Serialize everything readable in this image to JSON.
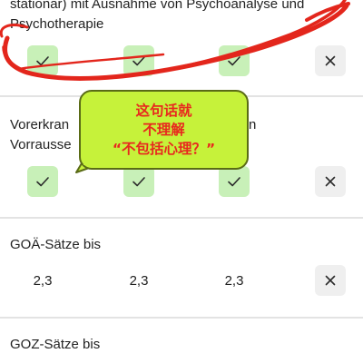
{
  "rows": [
    {
      "title_lines": [
        "stationar) mit Ausnahme von Psychoanalyse und",
        "Psychotherapie"
      ],
      "cells": [
        "check",
        "check",
        "check",
        "cross"
      ]
    },
    {
      "title_lines": [
        "Vorerkrankungen ohne besondere",
        "Vorraussetzungen versichert"
      ],
      "cells": [
        "check",
        "check",
        "check",
        "cross"
      ]
    },
    {
      "title": "GOÄ-Sätze bis",
      "values": [
        "2,3",
        "2,3",
        "2,3"
      ],
      "cells": [
        "cross"
      ]
    },
    {
      "title": "GOZ-Sätze bis"
    }
  ],
  "row2_visible_fragments": {
    "line1_left": "Vorerkran",
    "line1_right": "n",
    "line2_left": "Vorrausse"
  },
  "annotation": {
    "lines": [
      "这句话就",
      "不理解",
      "“不包括心理？”"
    ],
    "bubble_color": "#c6f23a",
    "text_color": "#e8281e",
    "scribble_color": "#e3261c"
  },
  "icons": {
    "check": "check-icon",
    "cross": "close-icon"
  },
  "colors": {
    "check_bg": "#c8f0b8",
    "cross_bg": "#efefef",
    "divider": "#e3e3e3"
  }
}
